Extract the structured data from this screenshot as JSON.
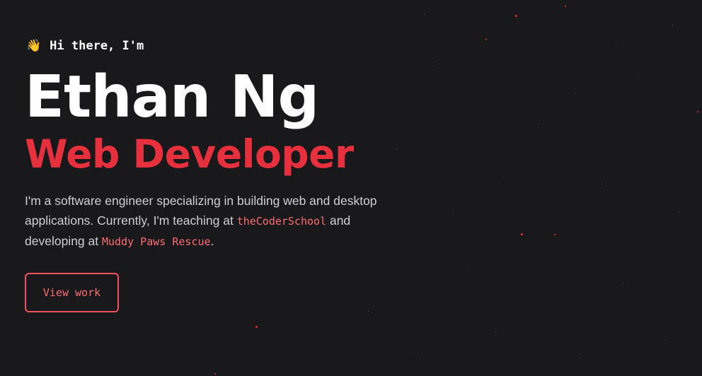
{
  "colors": {
    "background": "#19181a",
    "accent": "#e6303d",
    "link": "#ff6b75",
    "text": "#cfcfd3",
    "heading": "#ffffff"
  },
  "hero": {
    "wave_icon": "waving-hand-icon",
    "wave_glyph": "👋",
    "greeting": "Hi there, I'm",
    "name": "Ethan Ng",
    "role": "Web Developer",
    "bio": {
      "part1": "I'm a software engineer specializing in building web and desktop applications. Currently, I'm teaching at ",
      "link1": "theCoderSchool",
      "part2": " and developing at ",
      "link2": "Muddy Paws Rescue",
      "part3": "."
    },
    "cta_label": "View work"
  }
}
